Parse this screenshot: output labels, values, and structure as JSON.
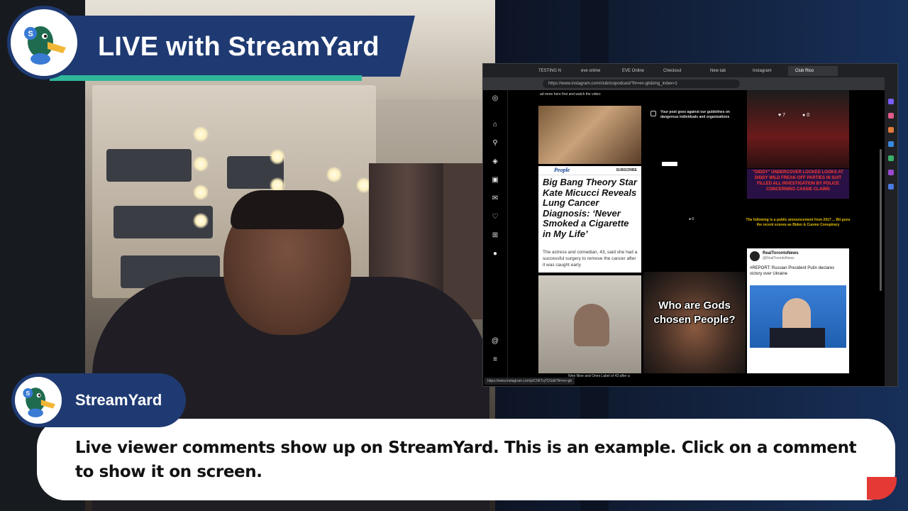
{
  "banner": {
    "title": "LIVE with StreamYard"
  },
  "comment": {
    "author": "StreamYard",
    "text": "Live viewer comments show up on StreamYard. This is an example. Click on a comment to show it on screen."
  },
  "browser": {
    "tabs": [
      {
        "label": "TESTING N"
      },
      {
        "label": "eve online"
      },
      {
        "label": "EVE Online"
      },
      {
        "label": "Checkout"
      },
      {
        "label": "New tab"
      },
      {
        "label": "Instagram"
      },
      {
        "label": "Club Rico"
      }
    ],
    "url": "https://www.instagram.com/clubricopodcast/?hl=en-gb&img_index=1",
    "status_url": "https://www.instagram.com/p/C0KTq7CGdb?hl=en-gb",
    "feed": {
      "intro_line": "ad more here first and watch the video:",
      "people_logo": "People",
      "people_subscribe": "SUBSCRIBE",
      "people_headline": "Big Bang Theory Star Kate Micucci Reveals Lung Cancer Diagnosis: ‘Never Smoked a Cigarette in My Life’",
      "people_dek": "The actress and comedian, 43, said she had a successful surgery to remove the cancer after it was caught early",
      "guidelines_title": "Your post goes against our guidelines on dangerous individuals and organizations",
      "likes_count": "7",
      "comments_count": "0",
      "meme_comment_count": "0",
      "meme_text": "Who are Gods chosen People?",
      "red_caption": "\"DIDDY\" UNDERCOVER LOCKED LOOKS AT DIDDY WILD FREAK-OFF PARTIES IN SUIT FILLED ALL INVESTIGATION BY POLICE CONCERNING CASSIE CLAIMS",
      "yellow_caption": "The following is a public announcement from 2017 ... Bit guns the recent scenes as Biden & Cuomo Conspiracy",
      "caption_bottom": "Nine Nine and Omni Label of 43 after a",
      "tweet_name": "RealTorontoNews",
      "tweet_handle": "@RealTorontoNews",
      "tweet_text": "#REPORT: Russian President Putin declares victory over Ukraine"
    },
    "rail_icons": [
      "instagram-icon",
      "home-icon",
      "search-icon",
      "explore-icon",
      "reels-icon",
      "messages-icon",
      "notifications-icon",
      "create-icon",
      "profile-icon",
      "threads-icon",
      "menu-icon"
    ]
  },
  "colors": {
    "brand_navy": "#1f3a72",
    "accent_teal": "#2fb79a",
    "alert_red": "#e53935"
  }
}
